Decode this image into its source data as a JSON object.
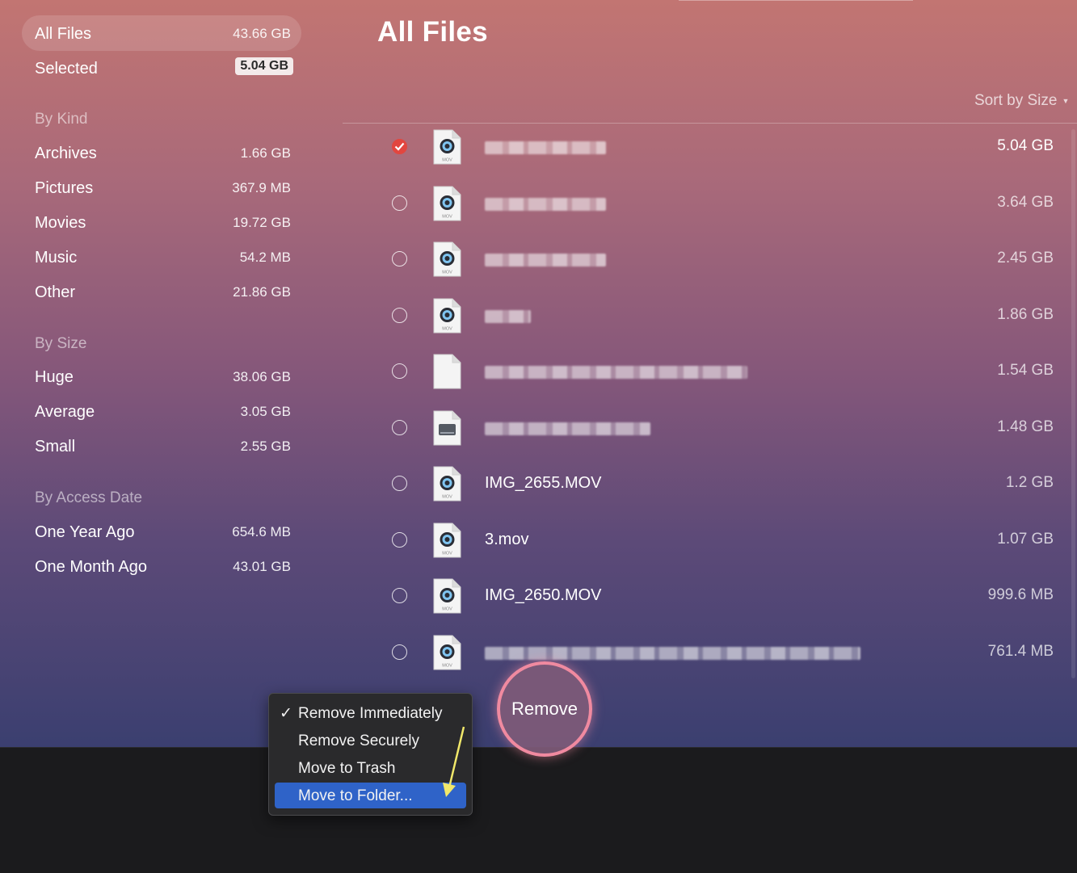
{
  "sidebar": {
    "all_files": {
      "label": "All Files",
      "size": "43.66 GB"
    },
    "selected": {
      "label": "Selected",
      "size": "5.04 GB"
    },
    "by_kind": {
      "heading": "By Kind",
      "items": [
        {
          "label": "Archives",
          "size": "1.66 GB"
        },
        {
          "label": "Pictures",
          "size": "367.9 MB"
        },
        {
          "label": "Movies",
          "size": "19.72 GB"
        },
        {
          "label": "Music",
          "size": "54.2 MB"
        },
        {
          "label": "Other",
          "size": "21.86 GB"
        }
      ]
    },
    "by_size": {
      "heading": "By Size",
      "items": [
        {
          "label": "Huge",
          "size": "38.06 GB"
        },
        {
          "label": "Average",
          "size": "3.05 GB"
        },
        {
          "label": "Small",
          "size": "2.55 GB"
        }
      ]
    },
    "by_access_date": {
      "heading": "By Access Date",
      "items": [
        {
          "label": "One Year Ago",
          "size": "654.6 MB"
        },
        {
          "label": "One Month Ago",
          "size": "43.01 GB"
        }
      ]
    }
  },
  "main": {
    "title": "All Files",
    "sort_label": "Sort by Size",
    "files": [
      {
        "name": "",
        "size": "5.04 GB",
        "icon": "mov-file-icon",
        "checked": true
      },
      {
        "name": "",
        "size": "3.64 GB",
        "icon": "mov-file-icon",
        "checked": false
      },
      {
        "name": "",
        "size": "2.45 GB",
        "icon": "mov-file-icon",
        "checked": false
      },
      {
        "name": "",
        "size": "1.86 GB",
        "icon": "mov-file-icon",
        "checked": false
      },
      {
        "name": "",
        "size": "1.54 GB",
        "icon": "blank-file-icon",
        "checked": false
      },
      {
        "name": "",
        "size": "1.48 GB",
        "icon": "disk-image-icon",
        "checked": false
      },
      {
        "name": "IMG_2655.MOV",
        "size": "1.2 GB",
        "icon": "mov-file-icon",
        "checked": false
      },
      {
        "name": "3.mov",
        "size": "1.07 GB",
        "icon": "mov-file-icon",
        "checked": false
      },
      {
        "name": "IMG_2650.MOV",
        "size": "999.6 MB",
        "icon": "mov-file-icon",
        "checked": false
      },
      {
        "name": "",
        "size": "761.4 MB",
        "icon": "mov-file-icon",
        "checked": false
      }
    ],
    "icon_badge": "MOV"
  },
  "remove_menu": {
    "items": [
      {
        "label": "Remove Immediately",
        "checked": true
      },
      {
        "label": "Remove Securely",
        "checked": false
      },
      {
        "label": "Move to Trash",
        "checked": false
      },
      {
        "label": "Move to Folder...",
        "checked": false,
        "highlighted": true
      }
    ],
    "checkmark": "✓"
  },
  "remove_button": {
    "label": "Remove"
  },
  "colors": {
    "accent_check": "#e2463f",
    "menu_highlight": "#2f63c8",
    "remove_ring": "#f08aa0",
    "annotation_arrow": "#f1e86a"
  }
}
